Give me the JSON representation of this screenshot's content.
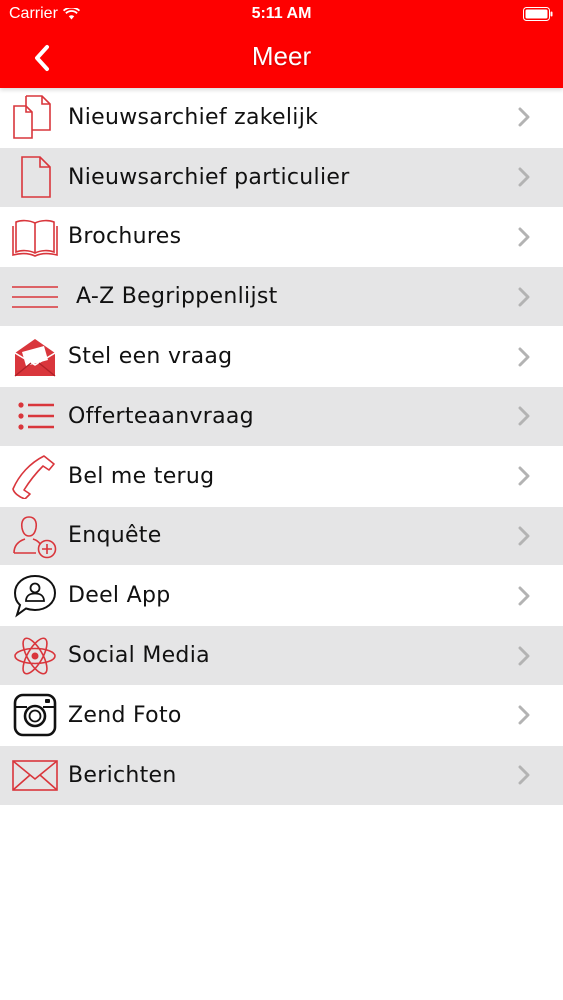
{
  "status_bar": {
    "carrier": "Carrier",
    "time": "5:11 AM"
  },
  "nav": {
    "title": "Meer"
  },
  "colors": {
    "brand_red": "#fe0000",
    "icon_red": "#d9363c",
    "row_alt": "#e5e5e6",
    "chevron": "#b3b3b3"
  },
  "menu": {
    "items": [
      {
        "label": "Nieuwsarchief zakelijk",
        "icon": "documents-icon"
      },
      {
        "label": "Nieuwsarchief particulier",
        "icon": "document-icon"
      },
      {
        "label": "Brochures",
        "icon": "book-icon"
      },
      {
        "label": "A-Z Begrippenlijst",
        "icon": "lines-icon"
      },
      {
        "label": "Stel een vraag",
        "icon": "envelope-open-icon"
      },
      {
        "label": "Offerteaanvraag",
        "icon": "list-icon"
      },
      {
        "label": "Bel me terug",
        "icon": "phone-icon"
      },
      {
        "label": "Enquête",
        "icon": "user-add-icon"
      },
      {
        "label": "Deel App",
        "icon": "share-chat-icon"
      },
      {
        "label": "Social Media",
        "icon": "atom-icon"
      },
      {
        "label": "Zend Foto",
        "icon": "camera-icon"
      },
      {
        "label": "Berichten",
        "icon": "mail-icon"
      }
    ]
  }
}
